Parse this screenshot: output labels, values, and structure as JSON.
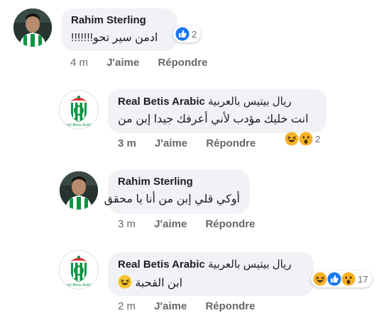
{
  "colors": {
    "like_blue": "#1877f2",
    "haha_yellow": "#f7b125",
    "betis_green": "#0b9444",
    "bubble_bg": "#f0f2f5"
  },
  "comments": [
    {
      "author": "Rahim Sterling",
      "text": "ادمن سير تحو!!!!!!!",
      "reactions_count": "2",
      "reactions": [
        "like-icon"
      ],
      "time": "4 m",
      "like_label": "J'aime",
      "reply_label": "Répondre"
    },
    {
      "author": "Real Betis Arabic",
      "author_arabic": "ريال بيتيس بالعربية",
      "text": "انت خليك مؤدب لأني أعرفك جيدا إبن من",
      "reactions_count": "2",
      "reactions": [
        "haha-icon",
        "wow-icon"
      ],
      "time": "3 m",
      "like_label": "J'aime",
      "reply_label": "Répondre"
    },
    {
      "author": "Rahim Sterling",
      "text": "أوكي قلي إبن من أنا يا محقق",
      "time": "3 m",
      "like_label": "J'aime",
      "reply_label": "Répondre"
    },
    {
      "author": "Real Betis Arabic",
      "author_arabic": "ريال بيتيس بالعربية",
      "text": "ابن القحبة",
      "text_emoji": "laughing-emoji",
      "reactions_count": "17",
      "reactions": [
        "haha-icon",
        "like-icon",
        "wow-icon"
      ],
      "time": "2 m",
      "like_label": "J'aime",
      "reply_label": "Répondre"
    }
  ]
}
